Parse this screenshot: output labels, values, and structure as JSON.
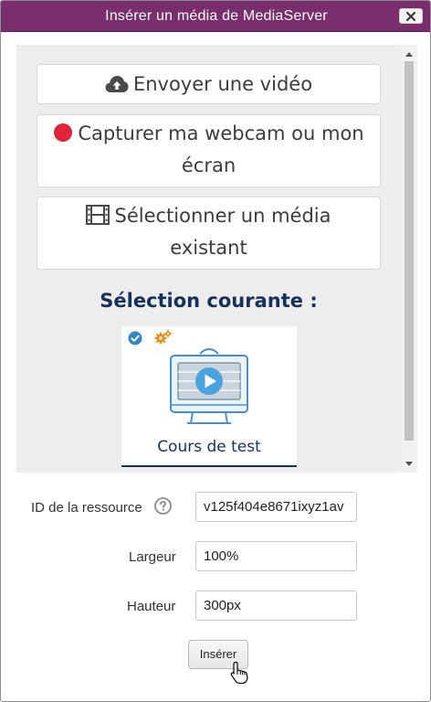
{
  "dialog": {
    "title": "Insérer un média de MediaServer",
    "close_icon": "close-x-icon"
  },
  "actions": {
    "upload": {
      "label": "Envoyer une vidéo",
      "icon": "cloud-upload-icon"
    },
    "webcam": {
      "label": "Capturer ma webcam ou mon écran",
      "icon": "record-dot-icon",
      "icon_color": "#e0243a"
    },
    "select": {
      "label": "Sélectionner un média existant",
      "icon": "film-icon"
    }
  },
  "selection": {
    "heading": "Sélection courante :",
    "media": {
      "title": "Cours de test",
      "status_icon": "check-circle-icon",
      "type_icon": "gears-icon",
      "thumbnail_icon": "video-monitor-icon"
    }
  },
  "form": {
    "resource_id": {
      "label": "ID de la ressource",
      "value": "v125f404e8671ixyz1av",
      "help_icon": "help-circle-icon"
    },
    "width": {
      "label": "Largeur",
      "value": "100%"
    },
    "height": {
      "label": "Hauteur",
      "value": "300px"
    },
    "insert_label": "Insérer"
  },
  "colors": {
    "title_bar": "#7a2e6e",
    "heading": "#16315c",
    "accent_blue": "#2f86c9",
    "gear_orange": "#e8901c",
    "record_red": "#e0243a"
  }
}
